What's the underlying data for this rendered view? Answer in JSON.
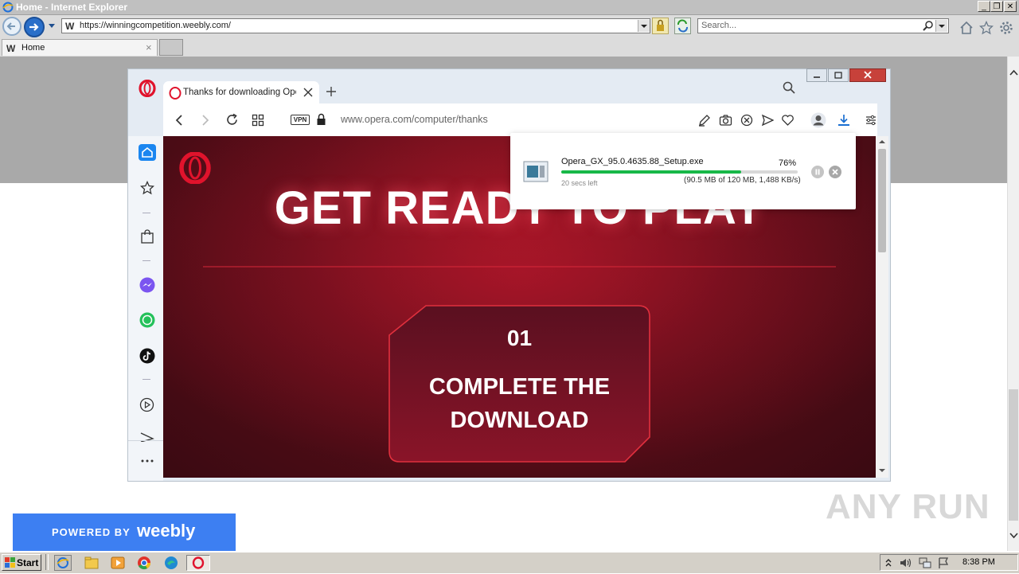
{
  "ie": {
    "window_title": "Home - Internet Explorer",
    "address_url": "https://winningcompetition.weebly.com/",
    "search_placeholder": "Search...",
    "tab_title": "Home"
  },
  "opera": {
    "tab_title": "Thanks for downloading Opera",
    "address_url": "www.opera.com/computer/thanks",
    "vpn_label": "VPN",
    "page": {
      "headline": "GET READY TO PLAY",
      "step_number": "01",
      "step_line1": "COMPLETE THE",
      "step_line2": "DOWNLOAD"
    },
    "download": {
      "filename": "Opera_GX_95.0.4635.88_Setup.exe",
      "percent_label": "76%",
      "progress": 0.76,
      "time_left": "20 secs left",
      "detail": "(90.5 MB of 120 MB, 1,488 KB/s)"
    }
  },
  "weebly": {
    "powered_by": "POWERED BY",
    "logo": "weebly"
  },
  "watermark": "ANY RUN",
  "taskbar": {
    "start_label": "Start",
    "clock": "8:38 PM"
  },
  "colors": {
    "opera_red": "#e0132c",
    "progress_green": "#18b848",
    "weebly_blue": "#3d7ff2",
    "page_dark_red": "#5a0d18"
  }
}
